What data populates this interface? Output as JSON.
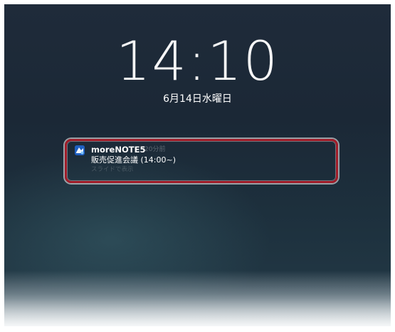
{
  "lock_screen": {
    "time": "14:10",
    "date": "6月14日水曜日"
  },
  "notification": {
    "icon": "morenote-app-icon",
    "app_name": "moreNOTE5",
    "time_ago": "20分前",
    "message": "販売促進会議 (14:00~)",
    "action_hint": "スライドで表示"
  },
  "colors": {
    "highlight_border": "#a11d2a",
    "app_icon": "#2a6fd0"
  }
}
